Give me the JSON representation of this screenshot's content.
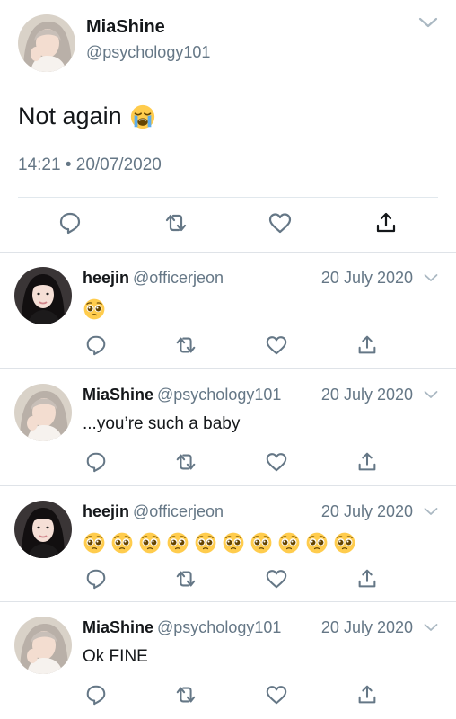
{
  "main_tweet": {
    "name": "MiaShine",
    "handle": "@psychology101",
    "text": "Not again",
    "emoji": "loudly-crying-face",
    "meta": "14:21 • 20/07/2020"
  },
  "replies": [
    {
      "name": "heejin",
      "handle": "@officerjeon",
      "date": "20 July 2020",
      "text": "",
      "emoji_count": 1,
      "emoji": "pleading-face",
      "avatar": "dark"
    },
    {
      "name": "MiaShine",
      "handle": "@psychology101",
      "date": "20 July 2020",
      "text": "...you’re such a baby",
      "emoji_count": 0,
      "avatar": "light"
    },
    {
      "name": "heejin",
      "handle": "@officerjeon",
      "date": "20 July 2020",
      "text": "",
      "emoji_count": 10,
      "emoji": "pleading-face",
      "avatar": "dark"
    },
    {
      "name": "MiaShine",
      "handle": "@psychology101",
      "date": "20 July 2020",
      "text": "Ok FINE",
      "emoji_count": 0,
      "avatar": "light"
    }
  ],
  "icons": [
    "reply-icon",
    "retweet-icon",
    "like-icon",
    "share-icon",
    "chevron-down-icon"
  ],
  "colors": {
    "secondary_text": "#657786",
    "icon_gray": "#657786",
    "divider": "#e1e8ed"
  }
}
